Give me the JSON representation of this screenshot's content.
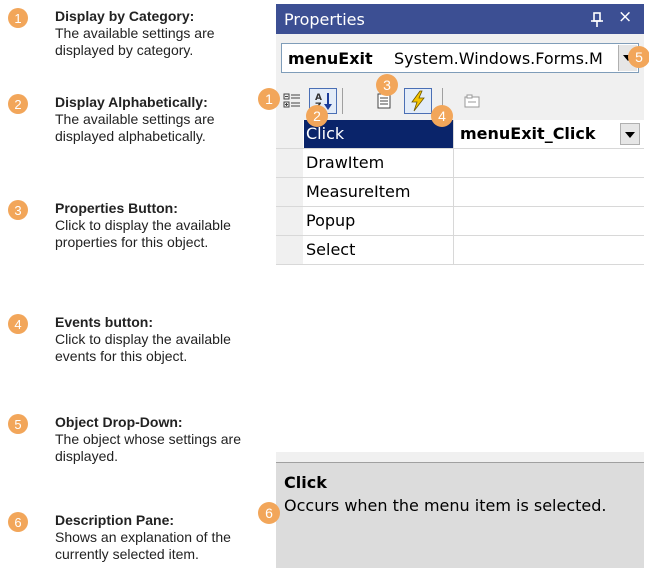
{
  "legend": [
    {
      "number": "1",
      "title": "Display by Category:",
      "desc": "The available settings are displayed by category."
    },
    {
      "number": "2",
      "title": "Display Alphabetically:",
      "desc": "The available settings are displayed alphabetically."
    },
    {
      "number": "3",
      "title": "Properties Button:",
      "desc": "Click to display the available properties for this object."
    },
    {
      "number": "4",
      "title": "Events button:",
      "desc": "Click to display the available events for this object."
    },
    {
      "number": "5",
      "title": "Object Drop-Down:",
      "desc": "The object whose settings are displayed."
    },
    {
      "number": "6",
      "title": "Description Pane:",
      "desc": "Shows an explanation of the currently selected item."
    }
  ],
  "window": {
    "title": "Properties",
    "pin_glyph": "\u0004",
    "close_glyph": "×"
  },
  "object_selector": {
    "name": "menuExit",
    "type": "System.Windows.Forms.M"
  },
  "toolbar": {
    "buttons": [
      "categorized-icon",
      "alphabetical-icon",
      "properties-icon",
      "events-icon",
      "property-pages-icon"
    ],
    "active": [
      "alphabetical",
      "events"
    ]
  },
  "grid": {
    "rows": [
      {
        "name": "Click",
        "value": "menuExit_Click",
        "selected": true
      },
      {
        "name": "DrawItem",
        "value": ""
      },
      {
        "name": "MeasureItem",
        "value": ""
      },
      {
        "name": "Popup",
        "value": ""
      },
      {
        "name": "Select",
        "value": ""
      }
    ]
  },
  "description": {
    "title": "Click",
    "text": "Occurs when the menu item is selected."
  },
  "callouts": [
    "1",
    "2",
    "3",
    "4",
    "5",
    "6"
  ],
  "colors": {
    "accent": "#f2a65a",
    "titlebar": "#3c4f93",
    "selection": "#0a246a"
  }
}
